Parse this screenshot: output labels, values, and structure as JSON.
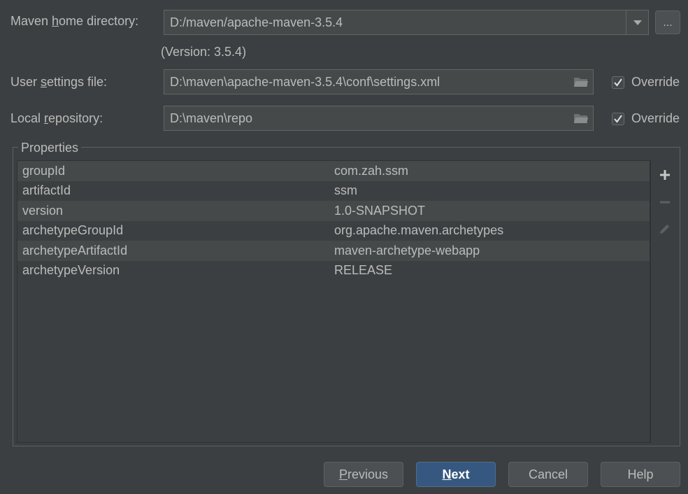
{
  "maven_home": {
    "label_pre": "Maven ",
    "label_mn": "h",
    "label_post": "ome directory:",
    "value": "D:/maven/apache-maven-3.5.4",
    "browse_label": "...",
    "version_note": "(Version: 3.5.4)"
  },
  "user_settings": {
    "label_pre": "User ",
    "label_mn": "s",
    "label_post": "ettings file:",
    "value": "D:\\maven\\apache-maven-3.5.4\\conf\\settings.xml",
    "override_label": "Override",
    "override_checked": true
  },
  "local_repo": {
    "label_pre": "Local ",
    "label_mn": "r",
    "label_post": "epository:",
    "value": "D:\\maven\\repo",
    "override_label": "Override",
    "override_checked": true
  },
  "properties": {
    "title": "Properties",
    "rows": [
      {
        "key": "groupId",
        "value": "com.zah.ssm"
      },
      {
        "key": "artifactId",
        "value": "ssm"
      },
      {
        "key": "version",
        "value": "1.0-SNAPSHOT"
      },
      {
        "key": "archetypeGroupId",
        "value": "org.apache.maven.archetypes"
      },
      {
        "key": "archetypeArtifactId",
        "value": "maven-archetype-webapp"
      },
      {
        "key": "archetypeVersion",
        "value": "RELEASE"
      }
    ],
    "tools": [
      "add-icon",
      "remove-icon",
      "edit-icon"
    ]
  },
  "buttons": {
    "previous_mn": "P",
    "previous_rest": "revious",
    "next_mn": "N",
    "next_rest": "ext",
    "cancel": "Cancel",
    "help": "Help"
  },
  "colors": {
    "background": "#3c3f41",
    "field": "#45494a",
    "primary_button": "#365880"
  }
}
